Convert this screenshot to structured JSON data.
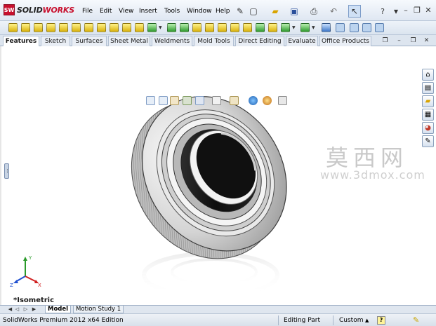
{
  "app": {
    "logo_mark": "SW",
    "logo_prefix": "SOLID",
    "logo_suffix": "WORKS"
  },
  "menu": [
    "File",
    "Edit",
    "View",
    "Insert",
    "Tools",
    "Window",
    "Help"
  ],
  "tabs": [
    {
      "label": "Features",
      "active": true
    },
    {
      "label": "Sketch",
      "active": false
    },
    {
      "label": "Surfaces",
      "active": false
    },
    {
      "label": "Sheet Metal",
      "active": false
    },
    {
      "label": "Weldments",
      "active": false
    },
    {
      "label": "Mold Tools",
      "active": false
    },
    {
      "label": "Direct Editing",
      "active": false
    },
    {
      "label": "Evaluate",
      "active": false
    },
    {
      "label": "Office Products",
      "active": false
    }
  ],
  "graphics": {
    "view_label": "*Isometric",
    "triad_labels": {
      "x": "X",
      "y": "Y",
      "z": "Z"
    },
    "watermark_cn": "莫西网",
    "watermark_url": "www.3dmox.com"
  },
  "model_tabs": [
    {
      "label": "Model",
      "active": true
    },
    {
      "label": "Motion Study 1",
      "active": false
    }
  ],
  "status": {
    "edition": "SolidWorks Premium 2012 x64 Edition",
    "mode": "Editing Part",
    "units": "Custom",
    "help": "?"
  },
  "colors": {
    "brand": "#c8102e",
    "toolbar_bg": "#dbe4ef",
    "watermark": "#c9c9c9"
  },
  "icons": {
    "quick_access": [
      "new-document-icon",
      "open-folder-icon",
      "save-icon",
      "print-icon",
      "undo-icon",
      "select-arrow-icon",
      "help-icon",
      "options-icon"
    ],
    "window_controls": [
      "minimize-icon",
      "restore-icon",
      "close-icon"
    ],
    "task_pane": [
      "solidworks-resources-icon",
      "design-library-icon",
      "file-explorer-icon",
      "view-palette-icon",
      "appearances-icon",
      "custom-properties-icon"
    ]
  }
}
